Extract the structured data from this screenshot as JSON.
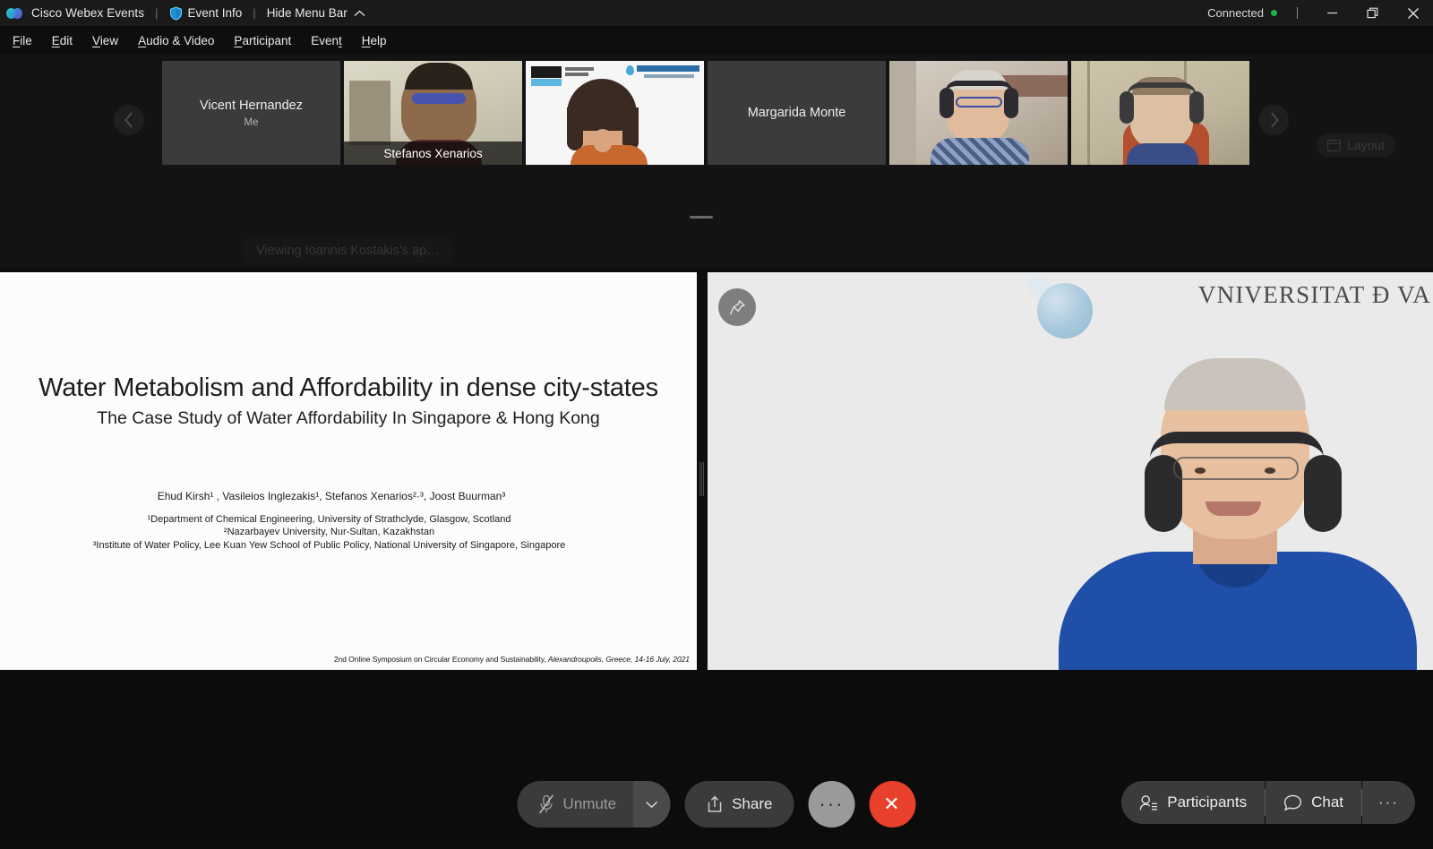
{
  "titlebar": {
    "app_name": "Cisco Webex Events",
    "separator": "|",
    "event_info": "Event Info",
    "separator2": "|",
    "hide_menu_bar": "Hide Menu Bar",
    "connection_status": "Connected",
    "accent_connected": "#21b04b",
    "minimize": "–",
    "restore": "❐",
    "close": "✕"
  },
  "menubar": {
    "items": [
      {
        "label": "File",
        "mnemonic": "F"
      },
      {
        "label": "Edit",
        "mnemonic": "E"
      },
      {
        "label": "View",
        "mnemonic": "V"
      },
      {
        "label": "Audio & Video",
        "mnemonic": "A"
      },
      {
        "label": "Participant",
        "mnemonic": "P"
      },
      {
        "label": "Event",
        "mnemonic": "t"
      },
      {
        "label": "Help",
        "mnemonic": "H"
      }
    ]
  },
  "filmstrip": {
    "layout_button": "Layout",
    "viewing_banner": "Viewing Ioannis Kostakis's ap…",
    "prev_arrow": "‹",
    "next_arrow": "›",
    "tiles": [
      {
        "name": "Vicent Hernandez",
        "subtitle": "Me",
        "video": false,
        "active": false
      },
      {
        "name": "Stefanos Xenarios",
        "subtitle": "",
        "video": true,
        "active": true
      },
      {
        "name": "",
        "subtitle": "",
        "video": true,
        "active": false
      },
      {
        "name": "Margarida Monte",
        "subtitle": "",
        "video": false,
        "active": false
      },
      {
        "name": "",
        "subtitle": "",
        "video": true,
        "active": false
      },
      {
        "name": "",
        "subtitle": "",
        "video": true,
        "active": false
      }
    ],
    "virtual_bg_logos": {
      "left": "IWA",
      "left_sub": "SPECIALIST GROUP",
      "right": "Water Economics Group",
      "right_sub": "Watereconomics"
    },
    "active_border_color": "#0bb8e8"
  },
  "slide": {
    "title": "Water Metabolism and Affordability in dense city-states",
    "subtitle": "The Case Study of Water Affordability In Singapore & Hong Kong",
    "authors": "Ehud Kirsh¹ , Vasileios Inglezakis¹, Stefanos Xenarios²·³, Joost Buurman³",
    "affiliations": [
      "¹Department of Chemical Engineering, University of Strathclyde, Glasgow, Scotland",
      "²Nazarbayev University, Nur-Sultan, Kazakhstan",
      "³Institute of Water Policy, Lee Kuan Yew School of Public Policy, National University of Singapore, Singapore"
    ],
    "footer_plain": "2nd Online Symposium on Circular  Economy and Sustainability, ",
    "footer_italic": "Alexandroupolis, Greece, 14-16 July, 2021"
  },
  "video_panel": {
    "virtual_background_text": "VNIVERSITAT Đ VA",
    "pin_tooltip": "Pin"
  },
  "controls": {
    "mute_label": "Unmute",
    "mute_caret": "⌄",
    "share_label": "Share",
    "more_label": "···",
    "leave_label": "✕",
    "participants_label": "Participants",
    "chat_label": "Chat",
    "right_more_label": "···",
    "leave_color": "#e8402a"
  }
}
